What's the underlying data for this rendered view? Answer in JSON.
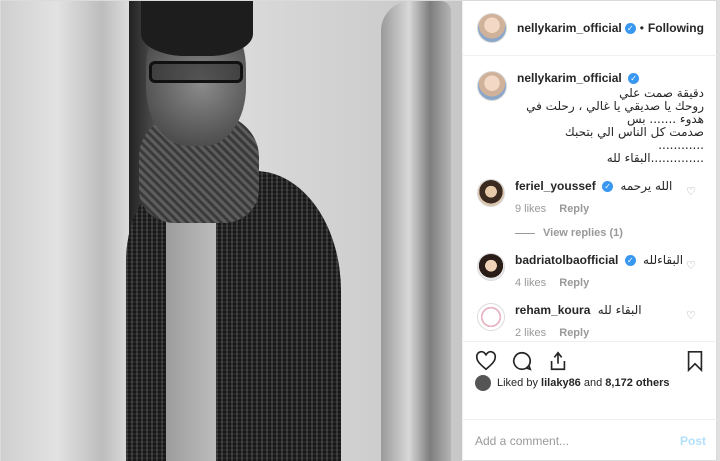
{
  "post": {
    "author": "nellykarim_official",
    "follow_status": "Following",
    "separator": "•"
  },
  "caption": {
    "author": "nellykarim_official",
    "text": "دقيقة صمت علي\nروحك يا صديقي يا غالي ، رحلت في هدوء ....... بس\nصدمت كل الناس الي بتحبك ............\n..............البقاء لله"
  },
  "comments": [
    {
      "user": "feriel_youssef",
      "verified": true,
      "text": "الله يرحمه",
      "likes": "9 likes",
      "reply": "Reply",
      "view_replies": "View replies (1)"
    },
    {
      "user": "badriatolbaofficial",
      "verified": true,
      "text": "البقاءلله",
      "likes": "4 likes",
      "reply": "Reply"
    },
    {
      "user": "reham_koura",
      "verified": false,
      "text": "البقاء لله",
      "likes": "2 likes",
      "reply": "Reply"
    }
  ],
  "likes_summary": {
    "prefix": "Liked by",
    "user": "lilaky86",
    "middle": "and",
    "count": "8,172 others"
  },
  "add_comment": {
    "placeholder": "Add a comment...",
    "post_label": "Post"
  },
  "icons": {
    "verified": "verified-badge-icon",
    "heart": "heart-icon",
    "comment": "comment-icon",
    "share": "share-icon",
    "save": "bookmark-icon"
  },
  "colors": {
    "verified": "#3897f0",
    "post_disabled": "#b2dffc",
    "muted": "#999999"
  }
}
